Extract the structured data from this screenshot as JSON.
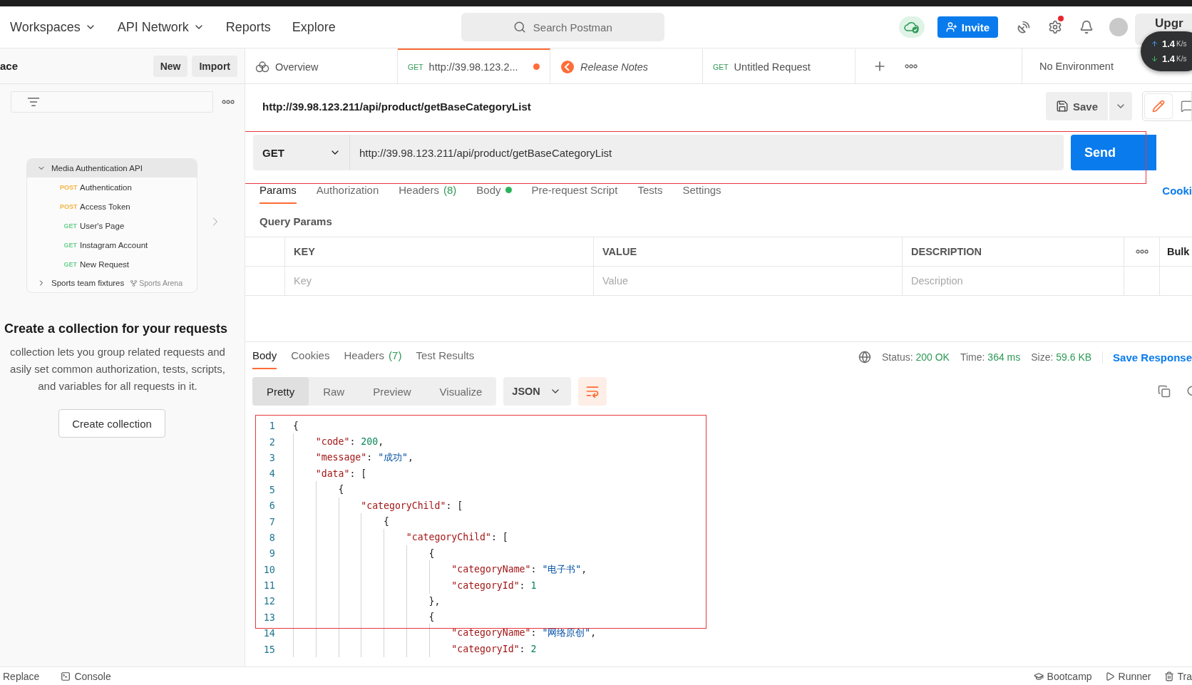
{
  "top_bar": {
    "nav": [
      {
        "label": "Workspaces",
        "dropdown": true
      },
      {
        "label": "API Network",
        "dropdown": true
      },
      {
        "label": "Reports",
        "dropdown": false
      },
      {
        "label": "Explore",
        "dropdown": false
      }
    ],
    "search": {
      "placeholder": "Search Postman"
    },
    "invite": "Invite",
    "settings_alert": true,
    "upgrade": "Upgr"
  },
  "network_speed": [
    {
      "kind": "up",
      "value": "1.4",
      "unit": "K/s"
    },
    {
      "kind": "down",
      "value": "1.4",
      "unit": "K/s"
    }
  ],
  "sidebar": {
    "workspace": "ace",
    "buttons": [
      "New",
      "Import"
    ],
    "collections": [
      {
        "name": "Media Authentication API",
        "expanded": true,
        "requests": [
          {
            "method": "POST",
            "color": "#f5b342",
            "name": "Authentication"
          },
          {
            "method": "POST",
            "color": "#f5b342",
            "name": "Access Token"
          },
          {
            "method": "GET",
            "color": "#6bcf8f",
            "name": "User's Page"
          },
          {
            "method": "GET",
            "color": "#6bcf8f",
            "name": "Instagram Account"
          },
          {
            "method": "GET",
            "color": "#6bcf8f",
            "name": "New Request"
          }
        ]
      },
      {
        "name": "Sports team fixtures",
        "expanded": false,
        "fork": "Sports Arena"
      }
    ],
    "empty_state": {
      "title": "Create a collection for your requests",
      "lines": [
        "collection lets you group related requests and",
        "asily set common authorization, tests, scripts,",
        "and variables for all requests in it."
      ],
      "button": "Create collection"
    }
  },
  "tabs": [
    {
      "kind": "overview",
      "label": "Overview",
      "selected": false
    },
    {
      "kind": "request",
      "method": "GET",
      "label": "http://39.98.123.2...",
      "selected": true,
      "unsaved": true
    },
    {
      "kind": "release_notes",
      "label": "Release Notes",
      "selected": false
    },
    {
      "kind": "request",
      "method": "GET",
      "label": "Untitled Request",
      "selected": false,
      "unsaved": false
    }
  ],
  "environment": "No Environment",
  "request": {
    "title": "http://39.98.123.211/api/product/getBaseCategoryList",
    "save": "Save",
    "method": "GET",
    "url": "http://39.98.123.211/api/product/getBaseCategoryList",
    "send": "Send",
    "highlighted": true
  },
  "request_tabs": [
    {
      "label": "Params",
      "selected": true
    },
    {
      "label": "Authorization",
      "selected": false
    },
    {
      "label": "Headers",
      "count": "(8)",
      "selected": false
    },
    {
      "label": "Body",
      "indicator": true,
      "selected": false
    },
    {
      "label": "Pre-request Script",
      "selected": false
    },
    {
      "label": "Tests",
      "selected": false
    },
    {
      "label": "Settings",
      "selected": false
    }
  ],
  "cookies_link": "Cooki",
  "query_params": {
    "title": "Query Params",
    "columns": [
      "KEY",
      "VALUE",
      "DESCRIPTION"
    ],
    "bulk": "Bulk",
    "placeholders": [
      "Key",
      "Value",
      "Description"
    ]
  },
  "response": {
    "tabs": [
      {
        "label": "Body",
        "selected": true
      },
      {
        "label": "Cookies",
        "selected": false
      },
      {
        "label": "Headers",
        "count": "(7)",
        "selected": false
      },
      {
        "label": "Test Results",
        "selected": false
      }
    ],
    "stats": [
      {
        "label": "Status:",
        "value": "200 OK"
      },
      {
        "label": "Time:",
        "value": "364 ms"
      },
      {
        "label": "Size:",
        "value": "59.6 KB"
      }
    ],
    "save": "Save Response",
    "formats": [
      {
        "label": "Pretty",
        "selected": true
      },
      {
        "label": "Raw",
        "selected": false
      },
      {
        "label": "Preview",
        "selected": false
      },
      {
        "label": "Visualize",
        "selected": false
      }
    ],
    "language": "JSON",
    "wrap_lines": true,
    "highlighted": true,
    "code_lines": [
      {
        "number": "1",
        "text": "{"
      },
      {
        "number": "2",
        "text": "    \"code\": 200,"
      },
      {
        "number": "3",
        "text": "    \"message\": \"成功\","
      },
      {
        "number": "4",
        "text": "    \"data\": ["
      },
      {
        "number": "5",
        "text": "        {"
      },
      {
        "number": "6",
        "text": "            \"categoryChild\": ["
      },
      {
        "number": "7",
        "text": "                {"
      },
      {
        "number": "8",
        "text": "                    \"categoryChild\": ["
      },
      {
        "number": "9",
        "text": "                        {"
      },
      {
        "number": "10",
        "text": "                            \"categoryName\": \"电子书\","
      },
      {
        "number": "11",
        "text": "                            \"categoryId\": 1"
      },
      {
        "number": "12",
        "text": "                        },"
      },
      {
        "number": "13",
        "text": "                        {"
      },
      {
        "number": "14",
        "text": "                            \"categoryName\": \"网络原创\","
      },
      {
        "number": "15",
        "text": "                            \"categoryId\": 2"
      }
    ]
  },
  "footer": {
    "left": [
      {
        "kind": "replace",
        "label": "Replace"
      },
      {
        "kind": "console",
        "label": "Console"
      }
    ],
    "right": [
      {
        "kind": "bootcamp",
        "label": "Bootcamp"
      },
      {
        "kind": "runner",
        "label": "Runner"
      },
      {
        "kind": "trash",
        "label": "Tra"
      }
    ]
  }
}
